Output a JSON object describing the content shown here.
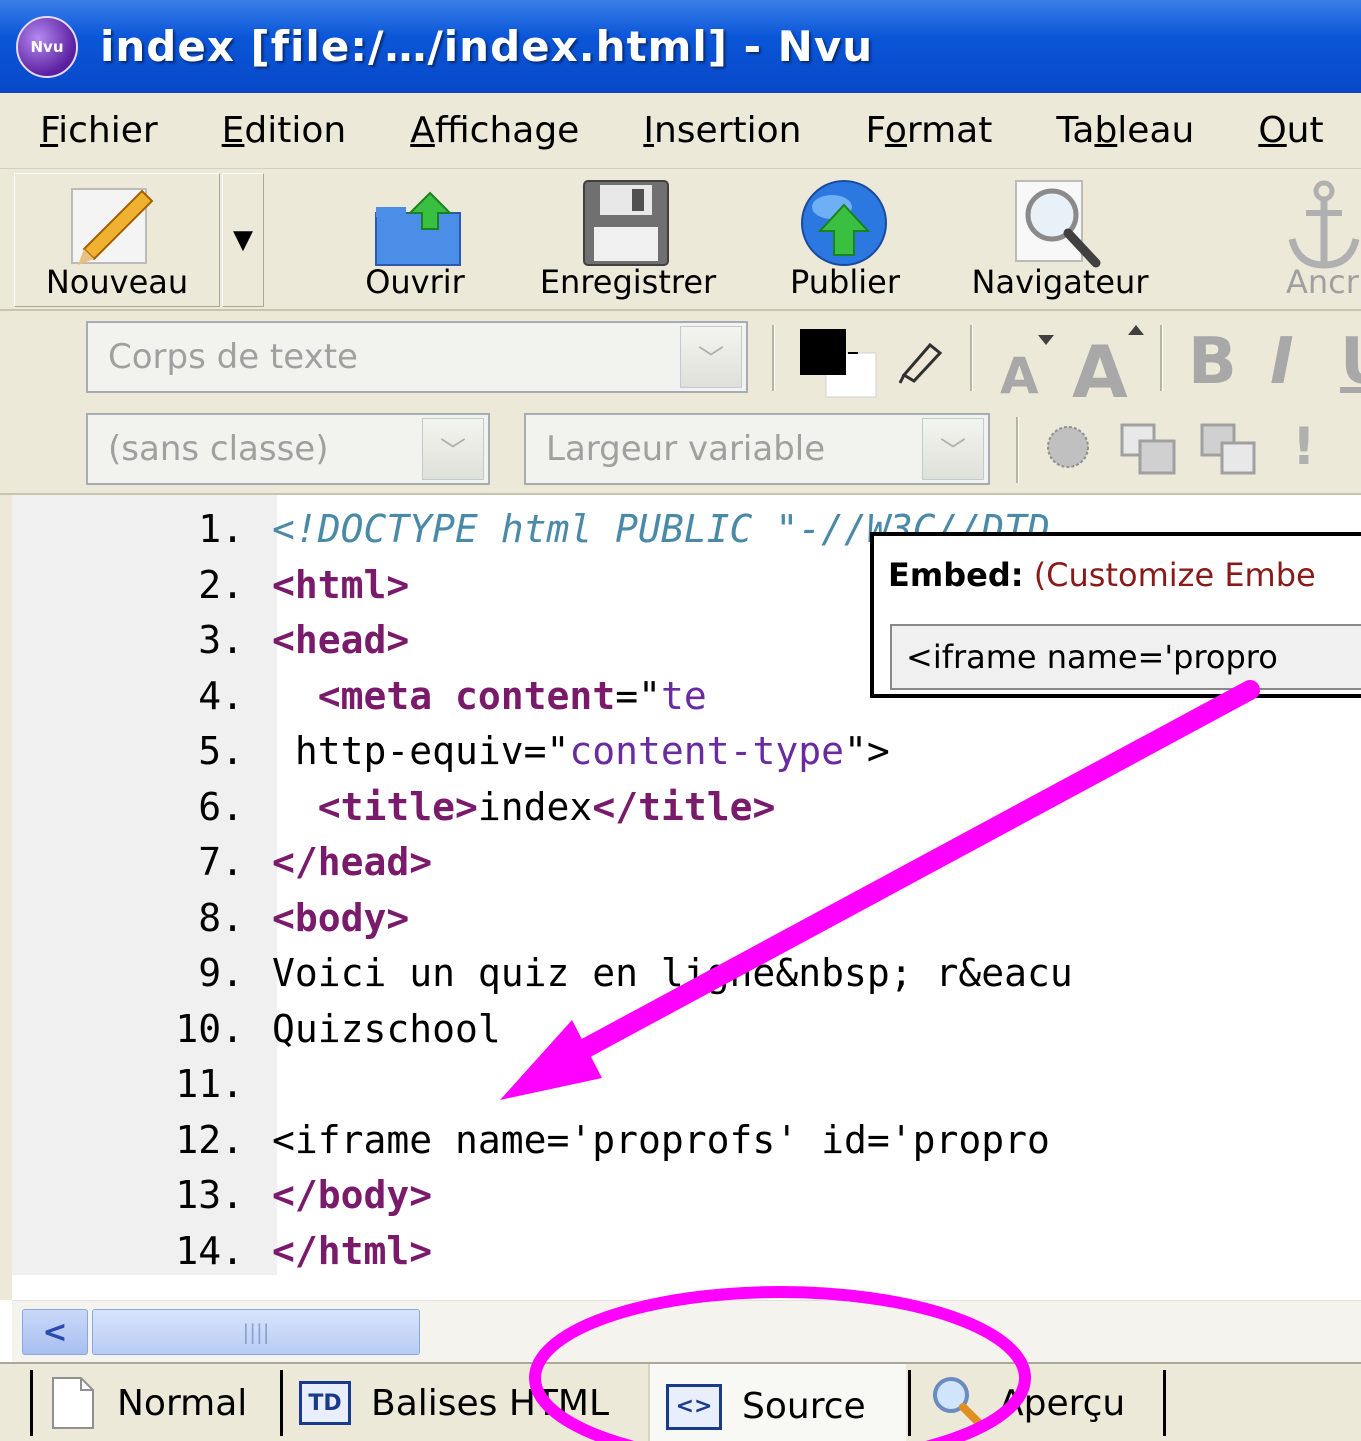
{
  "window": {
    "app_icon_label": "Nvu",
    "title": "index [file:/…/index.html] - Nvu"
  },
  "menubar": {
    "items": [
      {
        "pre": "",
        "u": "F",
        "post": "ichier"
      },
      {
        "pre": "",
        "u": "E",
        "post": "dition"
      },
      {
        "pre": "",
        "u": "A",
        "post": "ffichage"
      },
      {
        "pre": "",
        "u": "I",
        "post": "nsertion"
      },
      {
        "pre": "F",
        "u": "o",
        "post": "rmat"
      },
      {
        "pre": "Ta",
        "u": "b",
        "post": "leau"
      },
      {
        "pre": "",
        "u": "O",
        "post": "ut"
      }
    ]
  },
  "toolbar": {
    "nouveau": "Nouveau",
    "ouvrir": "Ouvrir",
    "enregistrer": "Enregistrer",
    "publier": "Publier",
    "navigateur": "Navigateur",
    "ancre": "Ancr"
  },
  "format": {
    "paragraph_style": "Corps de texte",
    "class_style": "(sans classe)",
    "width_style": "Largeur variable"
  },
  "editor": {
    "lines": [
      {
        "n": "1.",
        "parts": [
          [
            "cmt",
            "<!DOCTYPE html PUBLIC \"-//W3C//DTD"
          ]
        ]
      },
      {
        "n": "2.",
        "parts": [
          [
            "tag",
            "<html>"
          ]
        ]
      },
      {
        "n": "3.",
        "parts": [
          [
            "tag",
            "<head>"
          ]
        ]
      },
      {
        "n": "4.",
        "parts": [
          [
            "",
            "  "
          ],
          [
            "tag",
            "<meta"
          ],
          [
            "",
            " "
          ],
          [
            "attr",
            "content"
          ],
          [
            "",
            "=\""
          ],
          [
            "str",
            "te"
          ]
        ]
      },
      {
        "n": "5.",
        "parts": [
          [
            "",
            " http-equiv=\""
          ],
          [
            "str",
            "content-type"
          ],
          [
            "",
            "\">"
          ]
        ]
      },
      {
        "n": "6.",
        "parts": [
          [
            "",
            "  "
          ],
          [
            "tag",
            "<title>"
          ],
          [
            "",
            "index"
          ],
          [
            "tag",
            "</title>"
          ]
        ]
      },
      {
        "n": "7.",
        "parts": [
          [
            "tag",
            "</head>"
          ]
        ]
      },
      {
        "n": "8.",
        "parts": [
          [
            "tag",
            "<body>"
          ]
        ]
      },
      {
        "n": "9.",
        "parts": [
          [
            "",
            "Voici un quiz en ligne&nbsp; r&eacu"
          ]
        ]
      },
      {
        "n": "10.",
        "parts": [
          [
            "",
            "Quizschool"
          ]
        ]
      },
      {
        "n": "11.",
        "parts": [
          [
            "",
            ""
          ]
        ]
      },
      {
        "n": "12.",
        "parts": [
          [
            "",
            "<iframe name='proprofs' id='propro"
          ]
        ]
      },
      {
        "n": "13.",
        "parts": [
          [
            "tag",
            "</body>"
          ]
        ]
      },
      {
        "n": "14.",
        "parts": [
          [
            "tag",
            "</html>"
          ]
        ]
      }
    ]
  },
  "embed_popup": {
    "title": "Embed:",
    "subtitle": " (Customize Embe",
    "code": "<iframe name='propro"
  },
  "tabs": {
    "normal": "Normal",
    "balises_icon": "TD",
    "balises": "Balises HTML",
    "source_icon": "<>",
    "source": "Source",
    "apercu": "Aperçu"
  },
  "colors": {
    "annotation": "#ff00ff"
  }
}
